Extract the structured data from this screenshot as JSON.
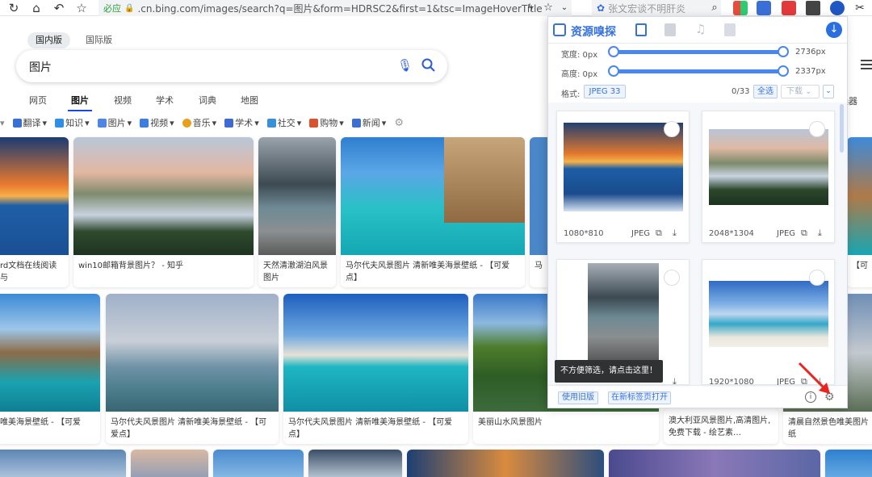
{
  "browser": {
    "url_badge": "必应",
    "url": ".cn.bing.com/images/search?q=图片&form=HDRSC2&first=1&tsc=ImageHoverTitle",
    "search_text": "张文宏谈不明肝炎"
  },
  "bing": {
    "region_tabs": [
      "国内版",
      "国际版"
    ],
    "query": "图片",
    "nav_tabs": [
      "网页",
      "图片",
      "视频",
      "学术",
      "词典",
      "地图"
    ],
    "filters": [
      "翻译",
      "知识",
      "图片",
      "视频",
      "音乐",
      "学术",
      "社交",
      "购物",
      "新闻"
    ],
    "filter_colors": [
      "#3b6fd8",
      "#2f8fe8",
      "#4e86e6",
      "#3b7de0",
      "#e6a21d",
      "#3f6ad6",
      "#3a90d8",
      "#d9532f",
      "#3d6fd0"
    ],
    "right_edge_text": "选器",
    "row1_captions": [
      "rd文档在线阅读与",
      "win10邮箱背景图片？ - 知乎",
      "天然清澈湖泊风景图片",
      "马尔代夫风景图片 清新唯美海景壁纸 - 【可爱点】",
      "马"
    ],
    "row1_right_caption": "【可",
    "row2_captions": [
      "唯美海景壁纸 - 【可爱",
      "马尔代夫风景图片 清新唯美海景壁纸 - 【可爱点】",
      "马尔代夫风景图片 清新唯美海景壁纸 - 【可爱点】",
      "美丽山水风景图片",
      "澳大利亚风景图片,高清图片,免费下载 - 绘艺素…",
      "清晨自然景色唯美图片纸"
    ]
  },
  "panel": {
    "title": "资源嗅探",
    "width_label": "宽度: 0px",
    "width_max": "2736px",
    "height_label": "高度: 0px",
    "height_max": "2337px",
    "format_label": "格式:",
    "format_value": "JPEG 33",
    "count": "0/33",
    "select_all": "全选",
    "download": "下载",
    "thumbs": [
      {
        "size": "1080*810",
        "fmt": "JPEG"
      },
      {
        "size": "2048*1304",
        "fmt": "JPEG"
      },
      {
        "size": "",
        "fmt": ""
      },
      {
        "size": "1920*1080",
        "fmt": "JPEG"
      }
    ],
    "tooltip": "不方便筛选，请点击这里！",
    "old_version": "使用旧版",
    "open_tab": "在新标签页打开"
  }
}
